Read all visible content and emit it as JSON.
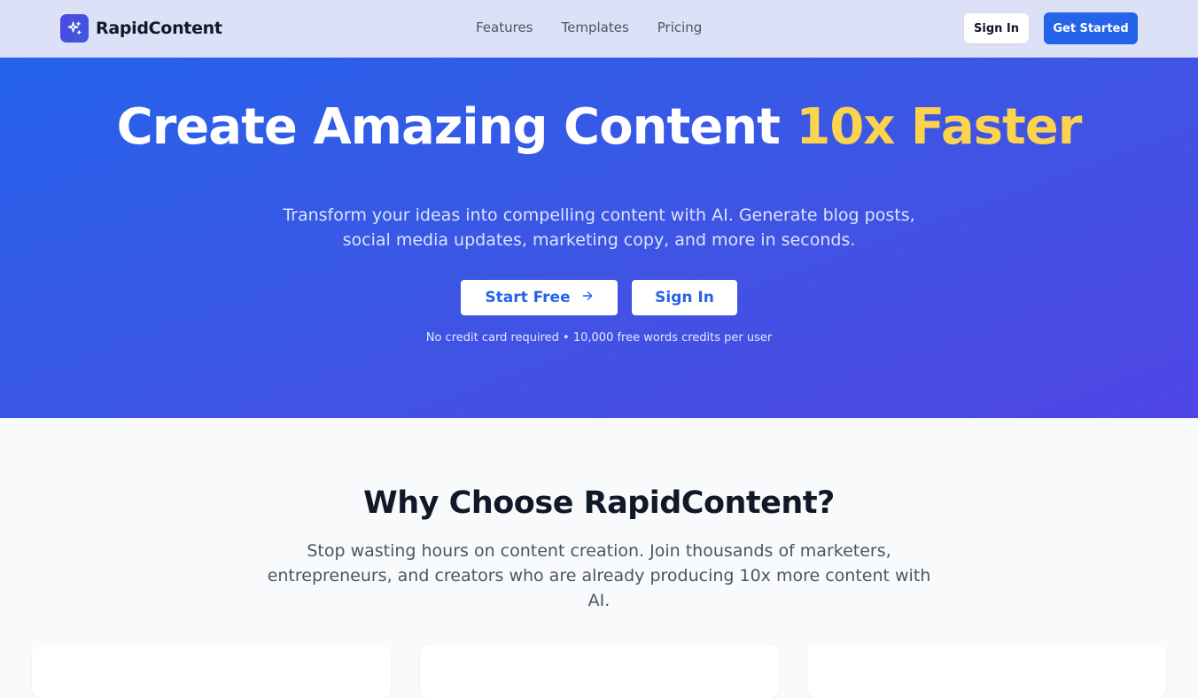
{
  "header": {
    "brand_name": "RapidContent",
    "brand_icon": "sparkles-icon",
    "nav": [
      {
        "label": "Features"
      },
      {
        "label": "Templates"
      },
      {
        "label": "Pricing"
      }
    ],
    "signin_label": "Sign In",
    "getstarted_label": "Get Started"
  },
  "hero": {
    "title_main": "Create Amazing Content ",
    "title_accent": "10x Faster",
    "subtitle": "Transform your ideas into compelling content with AI. Generate blog posts, social media updates, marketing copy, and more in seconds.",
    "start_label": "Start Free",
    "start_icon": "arrow-right-icon",
    "signin_label": "Sign In",
    "note": "No credit card required • 10,000 free words credits per user"
  },
  "why": {
    "title": "Why Choose RapidContent?",
    "subtitle": "Stop wasting hours on content creation. Join thousands of marketers, entrepreneurs, and creators who are already producing 10x more content with AI."
  },
  "colors": {
    "primary": "#2563eb",
    "accent_yellow": "#fcd34d",
    "hero_gradient_end": "#4f46e5"
  }
}
